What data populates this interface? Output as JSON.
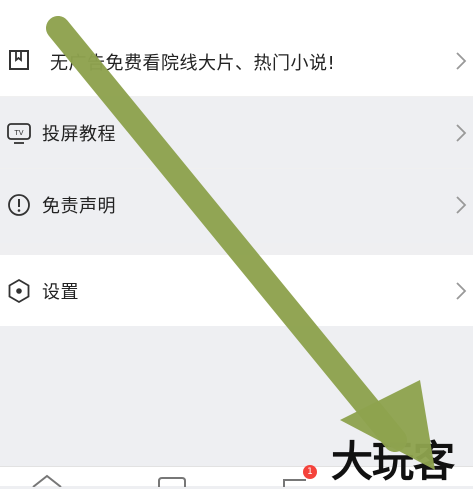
{
  "menu": {
    "items": [
      {
        "label": "无广告免费看院线大片、热门小说!",
        "icon": "bookmark-icon"
      },
      {
        "label": "投屏教程",
        "icon": "tv-icon"
      },
      {
        "label": "免责声明",
        "icon": "exclamation-circle-icon"
      }
    ],
    "settings": {
      "label": "设置",
      "icon": "hexagon-settings-icon"
    }
  },
  "tabbar": {
    "badge_count": "1"
  },
  "watermark": {
    "text": "大玩客"
  },
  "colors": {
    "arrow": "#8ea24e",
    "badge": "#f4433c",
    "background": "#eeeff2"
  }
}
